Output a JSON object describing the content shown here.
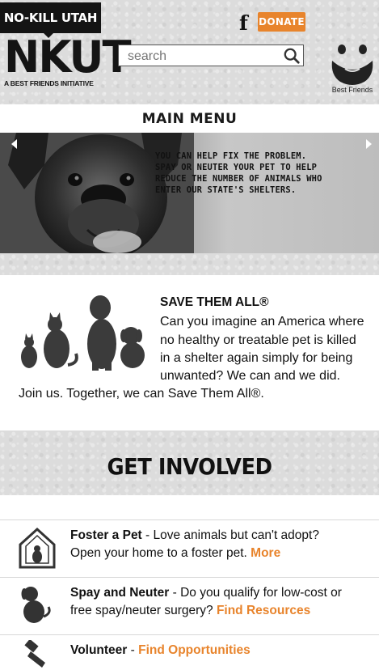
{
  "header": {
    "badge_label": "NO-KILL UTAH",
    "logo_text": "NKUT",
    "tagline": "A BEST FRIENDS INITIATIVE",
    "facebook_icon": "facebook-icon",
    "donate_label": "DONATE",
    "search_placeholder": "search",
    "partner_logo_label": "Best Friends"
  },
  "nav": {
    "main_menu_label": "MAIN MENU"
  },
  "hero": {
    "message": "YOU CAN HELP FIX THE PROBLEM. SPAY OR NEUTER YOUR PET TO HELP REDUCE THE NUMBER OF ANIMALS WHO ENTER OUR STATE'S SHELTERS.",
    "lines": [
      "YOU CAN HELP FIX THE PROBLEM.",
      "SPAY OR NEUTER YOUR PET TO HELP",
      "REDUCE THE NUMBER OF ANIMALS WHO",
      "ENTER OUR STATE'S SHELTERS."
    ]
  },
  "save_them_all": {
    "title": "SAVE THEM ALL®",
    "lines": [
      "Can you imagine an America where",
      "no healthy or treatable pet is killed",
      "in a shelter again simply for being",
      "unwanted? We can and we did.",
      "Join us. Together, we can Save Them All®."
    ]
  },
  "get_involved": {
    "title": "GET INVOLVED",
    "items": [
      {
        "title": "Foster a Pet",
        "desc_line1": " - Love animals but can't adopt?",
        "desc_line2": "Open your home to a foster pet. ",
        "link": "More",
        "icon": "house-cat-icon"
      },
      {
        "title": "Spay and Neuter",
        "desc_line1": " - Do you qualify for low-cost or",
        "desc_line2": "free spay/neuter surgery? ",
        "link": "Find Resources",
        "icon": "puppy-icon"
      },
      {
        "title": "Volunteer",
        "desc_line1": " - ",
        "link": "Find Opportunities",
        "icon": "brush-icon"
      }
    ]
  },
  "colors": {
    "accent": "#e8842c",
    "dark": "#141414",
    "texture": "#dcdcdc"
  }
}
